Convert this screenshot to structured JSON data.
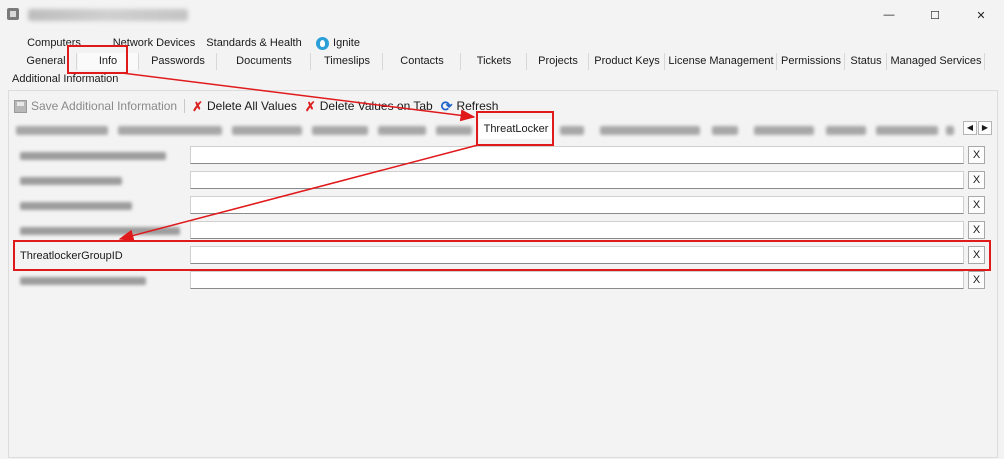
{
  "window": {
    "minimize_glyph": "—",
    "maximize_glyph": "☐",
    "close_glyph": "✕"
  },
  "tabs_row1": [
    "Computers",
    "Network Devices",
    "Standards & Health",
    "Ignite"
  ],
  "tabs_row2": [
    "General",
    "Info",
    "Passwords",
    "Documents",
    "Timeslips",
    "Contacts",
    "Tickets",
    "Projects",
    "Product Keys",
    "License Management",
    "Permissions",
    "Status",
    "Managed Services"
  ],
  "active_tab": "Info",
  "subtab": "Additional Information",
  "toolbar": {
    "save": "Save Additional Information",
    "delete_all": "Delete All Values",
    "delete_tab": "Delete Values on Tab",
    "refresh": "Refresh"
  },
  "category_tabs": {
    "active": "ThreatLocker",
    "scroll_left": "◀",
    "scroll_right": "▶"
  },
  "fields": [
    {
      "label": "ThreatlockerGroupID",
      "value": ""
    }
  ],
  "clear_label": "X",
  "colors": {
    "annotation": "#e0191b",
    "delete_icon": "#dd2222",
    "refresh_icon": "#1f64c8",
    "ignite_icon": "#2a9fd8"
  },
  "icons": {
    "app": "app-icon",
    "save": "save-icon",
    "delete": "x-icon",
    "refresh": "refresh-icon",
    "ignite": "ignite-icon"
  }
}
